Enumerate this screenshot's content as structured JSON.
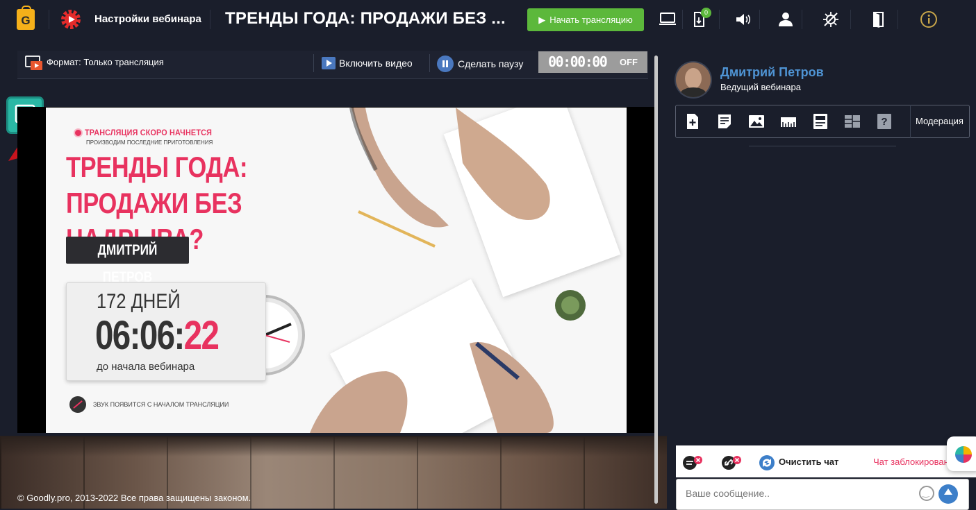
{
  "header": {
    "logo_letter": "G",
    "settings_label": "Настройки вебинара",
    "webinar_title": "ТРЕНДЫ ГОДА: ПРОДАЖИ БЕЗ ...",
    "start_button": "Начать трансляцию",
    "downloads_count": "0",
    "icons": [
      "screen-share-icon",
      "download-icon",
      "sound-icon",
      "user-icon",
      "effects-icon",
      "exit-icon",
      "info-icon"
    ]
  },
  "controls": {
    "format_label": "Формат: Только трансляция",
    "enable_video": "Включить видео",
    "pause": "Сделать паузу",
    "timer": "00:00:00",
    "timer_state": "OFF"
  },
  "slide": {
    "soon": "ТРАНСЛЯЦИЯ СКОРО НАЧНЕТСЯ",
    "soon_sub": "ПРОИЗВОДИМ ПОСЛЕДНИЕ ПРИГОТОВЛЕНИЯ",
    "title": "ТРЕНДЫ ГОДА: ПРОДАЖИ БЕЗ НАДРЫВА?",
    "speaker": "ДМИТРИЙ ПЕТРОВ",
    "days": "172 ДНЕЙ",
    "time_main": "06:06:",
    "time_sec": "22",
    "until": "до начала вебинара",
    "sound_note": "ЗВУК ПОЯВИТСЯ С НАЧАЛОМ ТРАНСЛЯЦИИ"
  },
  "host": {
    "name": "Дмитрий Петров",
    "role": "Ведущий вебинара"
  },
  "tools": {
    "moderation": "Модерация"
  },
  "chat": {
    "clear": "Очистить чат",
    "blocked": "Чат заблокирован",
    "placeholder": "Ваше сообщение.."
  },
  "footer": {
    "copyright": "© Goodly.pro, 2013-2022 Все права защищены законом."
  },
  "colors": {
    "accent_green": "#5cb83b",
    "accent_pink": "#e8325f",
    "host_blue": "#4f94d4",
    "teal_button": "#2ab8a5",
    "panel_bg": "#1a1e2b"
  }
}
